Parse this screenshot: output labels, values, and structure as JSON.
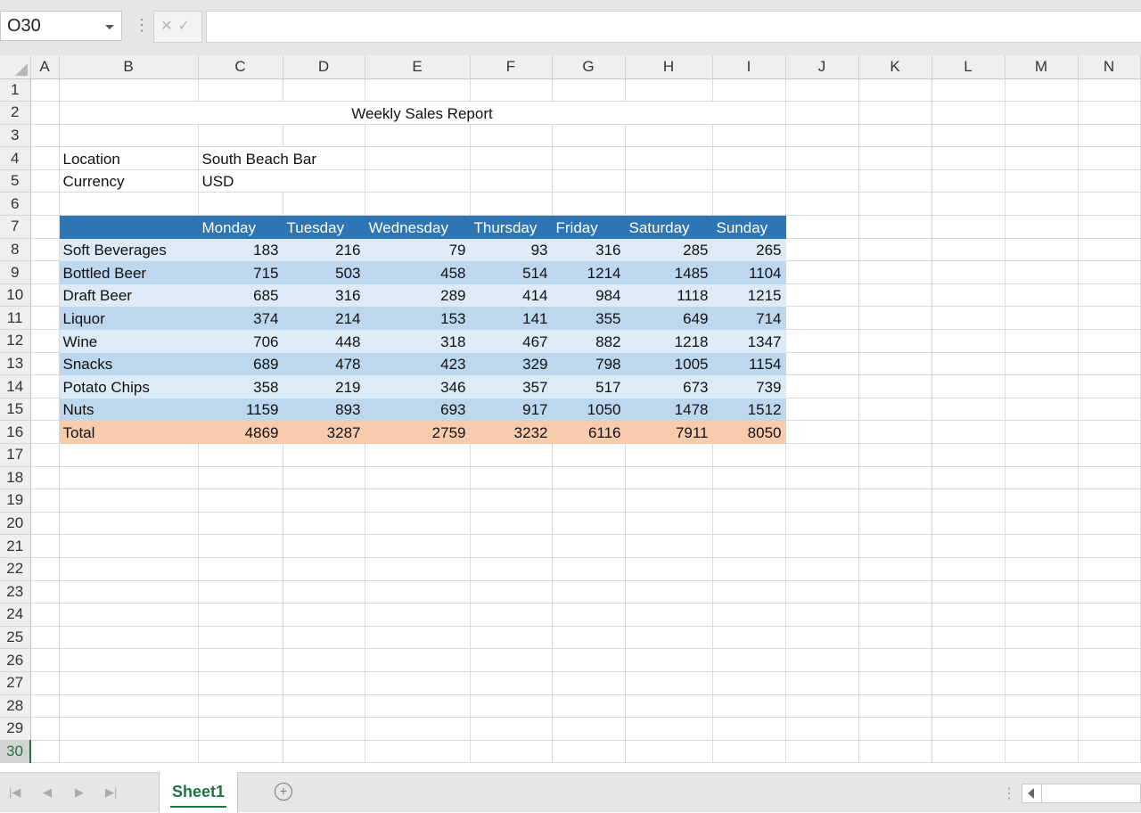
{
  "namebox": {
    "value": "O30"
  },
  "formula": {
    "cancel": "✕",
    "enter": "✓",
    "value": ""
  },
  "columns": [
    "A",
    "B",
    "C",
    "D",
    "E",
    "F",
    "G",
    "H",
    "I",
    "J",
    "K",
    "L",
    "M",
    "N"
  ],
  "active_row": 30,
  "report": {
    "title": "Weekly Sales Report",
    "location_label": "Location",
    "location_value": "South Beach Bar",
    "currency_label": "Currency",
    "currency_value": "USD",
    "days": [
      "Monday",
      "Tuesday",
      "Wednesday",
      "Thursday",
      "Friday",
      "Saturday",
      "Sunday"
    ],
    "rows": [
      {
        "label": "Soft Beverages",
        "values": [
          "183",
          "216",
          "79",
          "93",
          "316",
          "285",
          "265"
        ]
      },
      {
        "label": "Bottled Beer",
        "values": [
          "715",
          "503",
          "458",
          "514",
          "1214",
          "1485",
          "1104"
        ]
      },
      {
        "label": "Draft Beer",
        "values": [
          "685",
          "316",
          "289",
          "414",
          "984",
          "1118",
          "1215"
        ]
      },
      {
        "label": "Liquor",
        "values": [
          "374",
          "214",
          "153",
          "141",
          "355",
          "649",
          "714"
        ]
      },
      {
        "label": "Wine",
        "values": [
          "706",
          "448",
          "318",
          "467",
          "882",
          "1218",
          "1347"
        ]
      },
      {
        "label": "Snacks",
        "values": [
          "689",
          "478",
          "423",
          "329",
          "798",
          "1005",
          "1154"
        ]
      },
      {
        "label": "Potato Chips",
        "values": [
          "358",
          "219",
          "346",
          "357",
          "517",
          "673",
          "739"
        ]
      },
      {
        "label": "Nuts",
        "values": [
          "1159",
          "893",
          "693",
          "917",
          "1050",
          "1478",
          "1512"
        ]
      }
    ],
    "total": {
      "label": "Total",
      "values": [
        "4869",
        "3287",
        "2759",
        "3232",
        "6116",
        "7911",
        "8050"
      ]
    }
  },
  "sheet_tabs": [
    "Sheet1"
  ],
  "icons": {
    "first": "first-sheet-icon",
    "prev": "prev-sheet-icon",
    "next": "next-sheet-icon",
    "last": "last-sheet-icon",
    "add": "add-sheet-icon",
    "scroll_left": "scroll-left-icon",
    "dropdown": "chevron-down-icon"
  },
  "colors": {
    "header_fill": "#2e75b6",
    "band_light": "#ddebf7",
    "band_dark": "#bdd7ee",
    "total_fill": "#f8cbad",
    "accent": "#217346"
  }
}
